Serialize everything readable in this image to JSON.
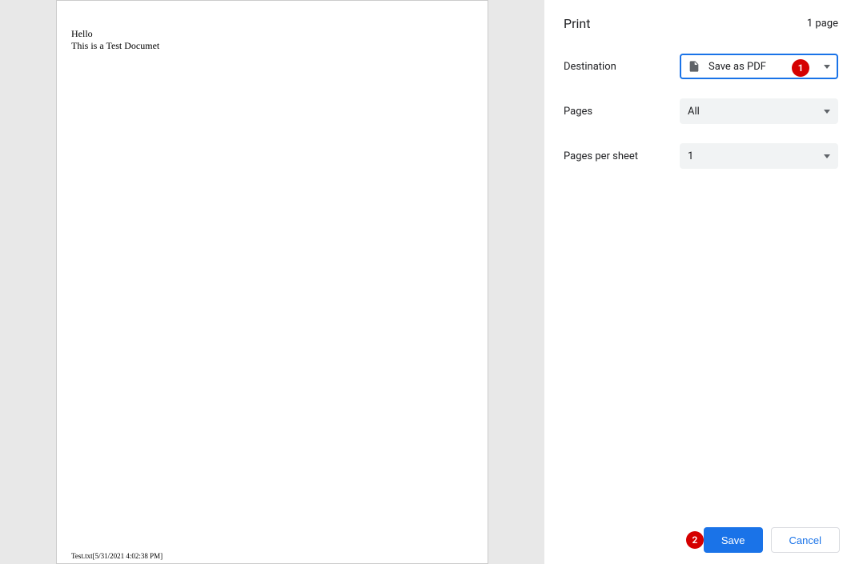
{
  "preview": {
    "lines": [
      "Hello",
      "This is a Test Documet"
    ],
    "footer": "Test.txt[5/31/2021 4:02:38 PM]"
  },
  "panel": {
    "title": "Print",
    "page_count": "1 page",
    "fields": {
      "destination": {
        "label": "Destination",
        "value": "Save as PDF"
      },
      "pages": {
        "label": "Pages",
        "value": "All"
      },
      "pages_per_sheet": {
        "label": "Pages per sheet",
        "value": "1"
      }
    },
    "buttons": {
      "save": "Save",
      "cancel": "Cancel"
    }
  },
  "annotations": {
    "badge1": "1",
    "badge2": "2"
  }
}
